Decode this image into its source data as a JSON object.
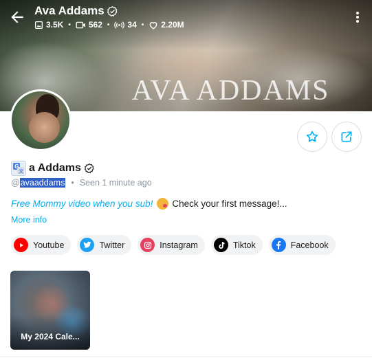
{
  "header": {
    "name": "Ava Addams",
    "stats": [
      {
        "icon": "image-icon",
        "value": "3.5K"
      },
      {
        "icon": "video-icon",
        "value": "562"
      },
      {
        "icon": "broadcast-icon",
        "value": "34"
      },
      {
        "icon": "heart-icon",
        "value": "2.20M"
      }
    ]
  },
  "cover": {
    "watermark": "AVA ADDAMS"
  },
  "profile": {
    "name_visible": "a Addams",
    "handle_prefix": "@",
    "handle": "avaaddams",
    "last_seen": "Seen  1 minute ago"
  },
  "bio": {
    "link_text": "Free Mommy video when you sub!",
    "emoji": "kissing-face-emoji",
    "text": "Check your first message!..."
  },
  "more_info": "More info",
  "socials": [
    {
      "label": "Youtube",
      "icon": "youtube-icon",
      "color": "#ff0000"
    },
    {
      "label": "Twitter",
      "icon": "twitter-icon",
      "color": "#1da1f2"
    },
    {
      "label": "Instagram",
      "icon": "instagram-icon",
      "color": "#e4405f"
    },
    {
      "label": "Tiktok",
      "icon": "tiktok-icon",
      "color": "#000000"
    },
    {
      "label": "Facebook",
      "icon": "facebook-icon",
      "color": "#1877f2"
    }
  ],
  "media": [
    {
      "title": "My 2024 Cale..."
    }
  ],
  "colors": {
    "accent": "#00aff0",
    "selection": "#2d5dc7",
    "muted": "#8a96a3"
  }
}
